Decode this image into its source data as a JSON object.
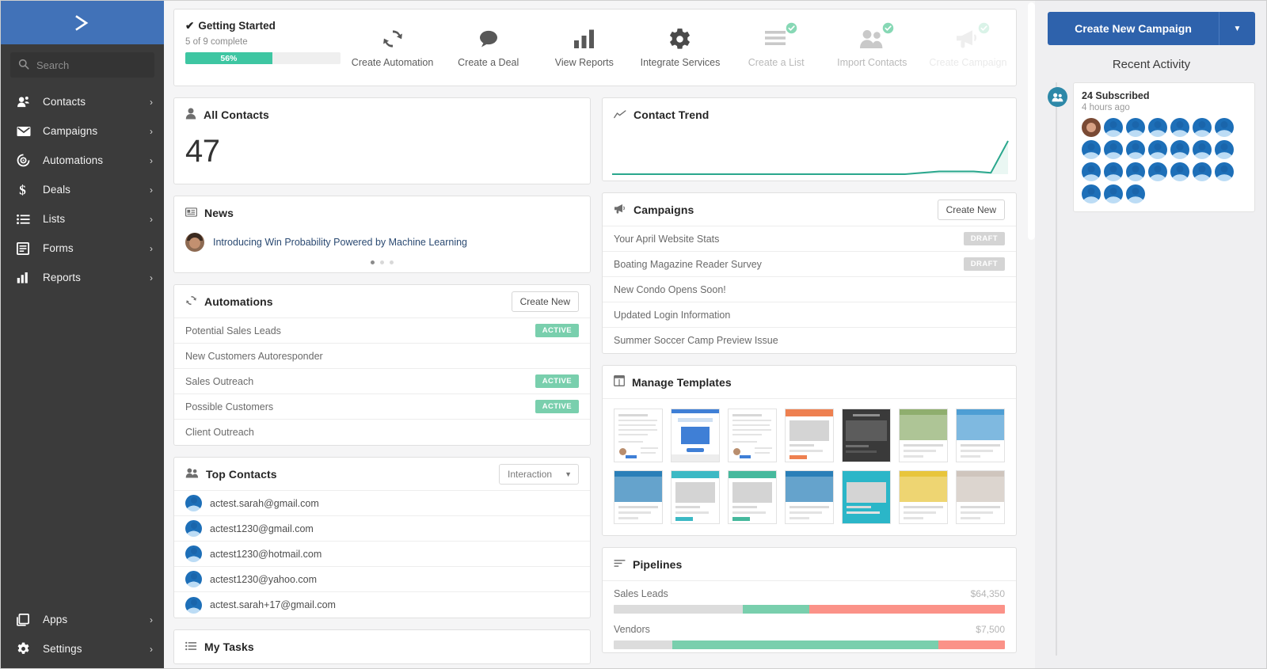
{
  "sidebar": {
    "logo_icon": "chevron-right-logo",
    "search": {
      "placeholder": "Search",
      "value": ""
    },
    "items": [
      {
        "label": "Contacts",
        "icon": "contacts-icon"
      },
      {
        "label": "Campaigns",
        "icon": "envelope-icon"
      },
      {
        "label": "Automations",
        "icon": "automations-icon"
      },
      {
        "label": "Deals",
        "icon": "dollar-icon"
      },
      {
        "label": "Lists",
        "icon": "list-icon"
      },
      {
        "label": "Forms",
        "icon": "forms-icon"
      },
      {
        "label": "Reports",
        "icon": "bar-chart-icon"
      }
    ],
    "bottom_items": [
      {
        "label": "Apps",
        "icon": "apps-icon"
      },
      {
        "label": "Settings",
        "icon": "gear-icon"
      }
    ],
    "chevron": "›"
  },
  "getting_started": {
    "title": "Getting Started",
    "check": "✔",
    "subtitle": "5 of 9 complete",
    "percent_label": "56%",
    "percent": 56,
    "steps": [
      {
        "label": "Create Automation",
        "icon": "refresh-icon",
        "done": false,
        "faded": false
      },
      {
        "label": "Create a Deal",
        "icon": "speech-bubble-icon",
        "done": false,
        "faded": false
      },
      {
        "label": "View Reports",
        "icon": "bar-chart-icon",
        "done": false,
        "faded": false
      },
      {
        "label": "Integrate Services",
        "icon": "gear-icon",
        "done": false,
        "faded": false
      },
      {
        "label": "Create a List",
        "icon": "lines-icon",
        "done": true,
        "faded": false
      },
      {
        "label": "Import Contacts",
        "icon": "two-people-icon",
        "done": true,
        "faded": false
      },
      {
        "label": "Create Campaign",
        "icon": "megaphone-icon",
        "done": true,
        "faded": true
      }
    ]
  },
  "all_contacts": {
    "title": "All Contacts",
    "icon": "person-icon",
    "count": "47"
  },
  "contact_trend": {
    "title": "Contact Trend",
    "icon": "trend-line-icon"
  },
  "news": {
    "title": "News",
    "icon": "news-card-icon",
    "headline": "Introducing Win Probability Powered by Machine Learning",
    "dots": 3,
    "active_dot": 0
  },
  "automations": {
    "title": "Automations",
    "icon": "refresh-icon",
    "create_label": "Create New",
    "rows": [
      {
        "name": "Potential Sales Leads",
        "status": "ACTIVE"
      },
      {
        "name": "New Customers Autoresponder",
        "status": ""
      },
      {
        "name": "Sales Outreach",
        "status": "ACTIVE"
      },
      {
        "name": "Possible Customers",
        "status": "ACTIVE"
      },
      {
        "name": "Client Outreach",
        "status": ""
      }
    ]
  },
  "campaigns": {
    "title": "Campaigns",
    "icon": "megaphone-icon",
    "create_label": "Create New",
    "rows": [
      {
        "name": "Your April Website Stats",
        "status": "DRAFT"
      },
      {
        "name": "Boating Magazine Reader Survey",
        "status": "DRAFT"
      },
      {
        "name": "New Condo Opens Soon!",
        "status": ""
      },
      {
        "name": "Updated Login Information",
        "status": ""
      },
      {
        "name": "Summer Soccer Camp Preview Issue",
        "status": ""
      }
    ]
  },
  "top_contacts": {
    "title": "Top Contacts",
    "icon": "two-people-icon",
    "filter": {
      "value": "Interaction",
      "caret": "▼"
    },
    "rows": [
      "actest.sarah@gmail.com",
      "actest1230@gmail.com",
      "actest1230@hotmail.com",
      "actest1230@yahoo.com",
      "actest.sarah+17@gmail.com"
    ]
  },
  "manage_templates": {
    "title": "Manage Templates",
    "icon": "template-grid-icon",
    "count": 14
  },
  "pipelines": {
    "title": "Pipelines",
    "icon": "pipeline-icon",
    "rows": [
      {
        "name": "Sales Leads",
        "value": "$64,350",
        "grey": 33,
        "green": 17,
        "red": 50
      },
      {
        "name": "Vendors",
        "value": "$7,500",
        "grey": 15,
        "green": 68,
        "red": 17
      }
    ]
  },
  "my_tasks": {
    "title": "My Tasks",
    "icon": "list-icon"
  },
  "right_panel": {
    "create_campaign_label": "Create New Campaign",
    "caret": "▼",
    "recent_activity_title": "Recent Activity",
    "activity": {
      "headline": "24 Subscribed",
      "time": "4 hours ago",
      "avatar_count": 24,
      "photo_index": 0,
      "bullet_icon": "two-people-icon"
    }
  },
  "colors": {
    "brand_blue": "#2e62ac",
    "logo_blue": "#4172b8",
    "sidebar": "#3b3b3b",
    "teal": "#3ec6a2",
    "green_badge": "#79cfad",
    "red_pipe": "#fb9288",
    "grey_badge": "#d4d4d4"
  },
  "chart_data": {
    "type": "line",
    "title": "Contact Trend",
    "x": [
      0,
      1,
      2,
      3,
      4,
      5,
      6,
      7,
      8,
      9,
      10,
      11,
      12,
      13,
      14,
      15,
      16,
      17,
      18,
      19,
      20,
      21,
      22,
      23
    ],
    "values": [
      0,
      0,
      0,
      0,
      0,
      0,
      0,
      0,
      0,
      0,
      0,
      0,
      0,
      0,
      0,
      0,
      0,
      0,
      1,
      2,
      2,
      2,
      1,
      24
    ],
    "ylim": [
      0,
      24
    ],
    "grid": false,
    "legend": "none",
    "line_color": "#2aa78d",
    "fill_color": "#d9f0ea"
  }
}
